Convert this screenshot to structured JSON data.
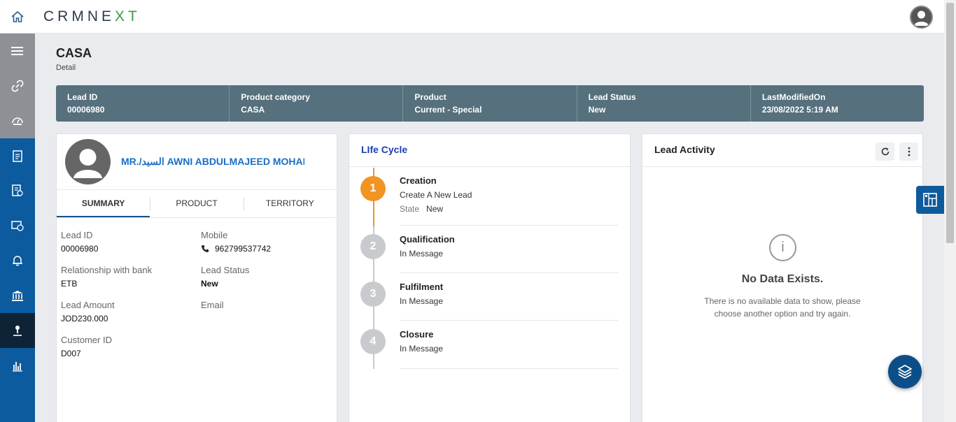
{
  "app": {
    "logo_part1": "CRMNE",
    "logo_part2": "XT"
  },
  "page": {
    "title": "CASA",
    "subtitle": "Detail"
  },
  "infobar": [
    {
      "label": "Lead ID",
      "value": "00006980"
    },
    {
      "label": "Product category",
      "value": "CASA"
    },
    {
      "label": "Product",
      "value": "Current - Special"
    },
    {
      "label": "Lead Status",
      "value": "New"
    },
    {
      "label": "LastModifiedOn",
      "value": "23/08/2022 5:19 AM"
    }
  ],
  "sidebar": {
    "icons": [
      "menu-icon",
      "link-icon",
      "dashboard-icon",
      "clipboard-icon",
      "document-check-icon",
      "card-money-icon",
      "bell-icon",
      "bank-icon",
      "user-pin-icon",
      "bar-chart-icon"
    ]
  },
  "profile": {
    "name": "MR./السيد AWNI ABDULMAJEED MOHAMMAD",
    "tabs": [
      "SUMMARY",
      "PRODUCT",
      "TERRITORY"
    ],
    "fields": {
      "lead_id": {
        "label": "Lead ID",
        "value": "00006980"
      },
      "mobile": {
        "label": "Mobile",
        "value": "962799537742"
      },
      "relationship": {
        "label": "Relationship with bank",
        "value": "ETB"
      },
      "lead_status": {
        "label": "Lead Status",
        "value": "New"
      },
      "lead_amount": {
        "label": "Lead Amount",
        "value": "JOD230.000"
      },
      "email": {
        "label": "Email",
        "value": ""
      },
      "customer_id": {
        "label": "Customer ID",
        "value": "D007"
      }
    }
  },
  "lifecycle": {
    "title": "LIfe Cycle",
    "steps": [
      {
        "num": "1",
        "name": "Creation",
        "desc": "Create A New Lead",
        "state_label": "State",
        "state_value": "New"
      },
      {
        "num": "2",
        "name": "Qualification",
        "desc": "In Message"
      },
      {
        "num": "3",
        "name": "Fulfilment",
        "desc": "In Message"
      },
      {
        "num": "4",
        "name": "Closure",
        "desc": "In Message"
      }
    ]
  },
  "activity": {
    "title": "Lead Activity",
    "empty_title": "No Data Exists.",
    "empty_text": "There is no available data to show, please choose another option and try again."
  },
  "colors": {
    "brand_blue": "#0c5b9e",
    "accent_orange": "#f29423",
    "infobar": "#56707d",
    "logo_green": "#3a9a4d"
  }
}
